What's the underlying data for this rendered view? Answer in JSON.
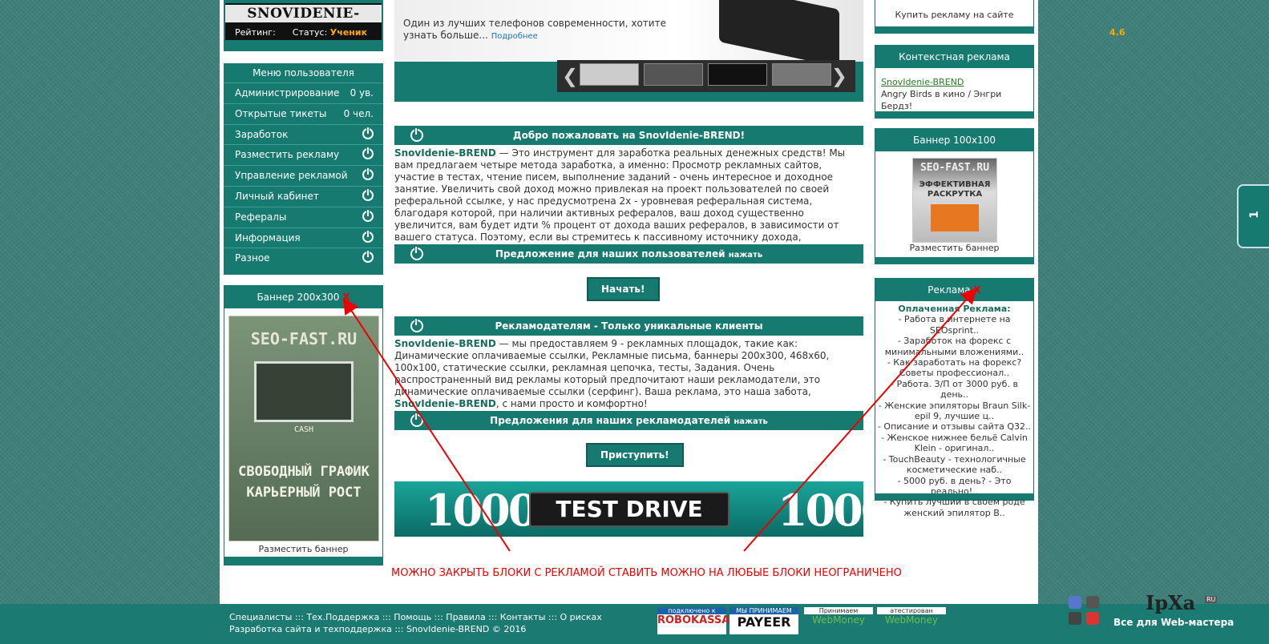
{
  "left": {
    "logo": "SNOVIDENIE-BREND",
    "rating_label": "Рейтинг:",
    "rating_value": "4.6",
    "status_label": "Статус:",
    "status_value": "Ученик",
    "menu_title": "Меню пользователя",
    "menu": [
      {
        "label": "Администрирование",
        "value": "0 ув."
      },
      {
        "label": "Открытые тикеты",
        "value": "0 чел."
      },
      {
        "label": "Заработок"
      },
      {
        "label": "Разместить рекламу"
      },
      {
        "label": "Управление рекламой"
      },
      {
        "label": "Личный кабинет"
      },
      {
        "label": "Рефералы"
      },
      {
        "label": "Информация"
      },
      {
        "label": "Разное"
      }
    ],
    "banner_title": "Баннер 200x300",
    "close_x": "X",
    "promo_site": "SEO-FAST.RU",
    "promo_text": "СВОБОДНЫЙ ГРАФИК КАРЬЕРНЫЙ РОСТ",
    "promo_cash": "CASH",
    "place_banner": "Разместить баннер"
  },
  "slider": {
    "text": "Один из лучших телефонов современности, хотите узнать больше...",
    "more": "Подробнее"
  },
  "center": {
    "welcome_title": "Добро пожаловать на SnovIdenie-BREND!",
    "brand": "SnovIdenie-BREND",
    "welcome_text": " — Это инструмент для заработка реальных денежных средств! Мы вам предлагаем четыре метода заработка, а именно: Просмотр рекламных сайтов, участие в тестах, чтение писем, выполнение заданий - очень интересное и доходное занятие. Увеличить свой доход можно привлекая на проект пользователей по своей реферальной ссылке, у нас предусмотрена 2х - уровневая реферальная система, благодаря которой, при наличии активных рефералов, ваш доход существенно увеличится, вам будет идти % процент от дохода ваших рефералов, в зависимости от вашего статуса. Поэтому, если вы стремитесь к пассивному источнику дохода, рекомендуем вам привлекать рефералов.",
    "offer_users": "Предложение для наших пользователей",
    "press": "нажать",
    "start_btn": "Начать!",
    "adv_title": "Рекламодателям - Только уникальные клиенты",
    "adv_text1": " — мы предоставляем 9 - рекламных площадок, такие как: Динамические оплачиваемые ссылки, Рекламные письма, баннеры 200x300, 468x60, 100x100, статические ссылки, рекламная цепочка, тесты, Задания. Очень распространенный вид рекламы который предпочитают наши рекламодатели, это динамические оплачиваемые ссылки (серфинг). Ваша реклама, это наша забота, ",
    "adv_text2": ", с нами просто и комфортно!",
    "offer_adv": "Предложения для наших рекламодателей",
    "proceed_btn": "Приступить!",
    "td_num": "1000",
    "td_logo": "TEST DRIVE",
    "note": "МОЖНО ЗАКРЫТЬ БЛОКИ С РЕКЛАМОЙ СТАВИТЬ МОЖНО НА ЛЮБЫЕ БЛОКИ НЕОГРАНИЧЕНО"
  },
  "right": {
    "buy_ad": "Купить рекламу на сайте",
    "context_title": "Контекстная реклама",
    "context_link": "SnovIdenie-BREND",
    "context_text": "Angry Birds в кино / Энгри Бердз!",
    "banner100_title": "Баннер 100x100",
    "b100_site": "SEO-FAST.RU",
    "b100_text": "ЭФФЕКТИВНАЯ РАСКРУТКА",
    "place_banner": "Разместить баннер",
    "ads_title": "Реклама",
    "close_x": "X",
    "paid_title": "Оплаченная Реклама:",
    "ads": [
      "- Работа в интернете на SEOsprint..",
      "- Заработок на форекс с минимальными вложениями..",
      "- Как заработать на форекс? Советы профессионал..",
      "- Работа. З/П от 3000 руб. в день..",
      "- Женские эпиляторы Braun Silk-epil 9, лучшие ц..",
      "- Описание и отзывы сайта Q32..",
      "- Женское нижнее бельё Calvin Klein - оригинал..",
      "- TouchBeauty - технологичные косметические наб..",
      "- 5000 руб. в день? - Это реально!..",
      "- Купить лучший в своём роде женский эпилятор В.."
    ]
  },
  "footer": {
    "links": "Специалисты ::: Тех.Поддержка ::: Помощь ::: Правила ::: Контакты ::: О рисках",
    "copyright": "Разработка сайта и техподдержка ::: SnovIdenie-BREND © 2016",
    "robokassa_top": "подключено к",
    "robokassa": "ROBOKASSA",
    "payeer_top": "МЫ ПРИНИМАЕМ",
    "payeer": "PAYEER",
    "wm1_top": "Принимаем",
    "wm2_top": "атестирован",
    "wm": "WebMoney",
    "ipxa": "IpXa",
    "ipxa_ru": "RU",
    "ipxa_sub": "Все для Web-мастера"
  },
  "side_tab": "1"
}
